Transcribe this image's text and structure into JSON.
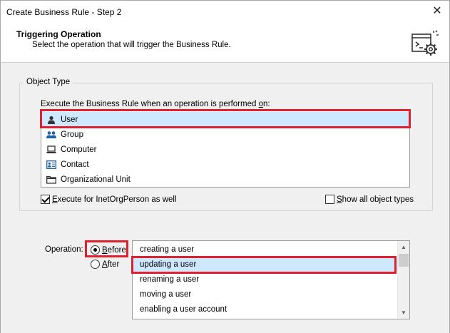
{
  "window": {
    "title": "Create Business Rule - Step 2",
    "close_glyph": "✕"
  },
  "header": {
    "title": "Triggering Operation",
    "subtitle": "Select the operation that will trigger the Business Rule.",
    "icon": "settings-gear-window-icon"
  },
  "object_type": {
    "group_label": "Object Type",
    "prompt_pre": "Execute the Business Rule when an operation is performed ",
    "prompt_accel": "o",
    "prompt_post": "n:",
    "items": [
      {
        "label": "User",
        "icon": "user-icon",
        "selected": true
      },
      {
        "label": "Group",
        "icon": "group-icon",
        "selected": false
      },
      {
        "label": "Computer",
        "icon": "computer-icon",
        "selected": false
      },
      {
        "label": "Contact",
        "icon": "contact-icon",
        "selected": false
      },
      {
        "label": "Organizational Unit",
        "icon": "folder-icon",
        "selected": false
      }
    ],
    "inetorg": {
      "accel": "E",
      "rest": "xecute for InetOrgPerson as well",
      "checked": true
    },
    "show_all": {
      "accel": "S",
      "rest": "how all object types",
      "checked": false
    }
  },
  "operation": {
    "label": "Operation:",
    "before": {
      "accel": "B",
      "rest": "efore",
      "checked": true
    },
    "after": {
      "accel": "A",
      "rest": "fter",
      "checked": false
    },
    "items": [
      {
        "label": "creating a user",
        "selected": false
      },
      {
        "label": "updating a user",
        "selected": true
      },
      {
        "label": "renaming a user",
        "selected": false
      },
      {
        "label": "moving a user",
        "selected": false
      },
      {
        "label": "enabling a user account",
        "selected": false
      }
    ]
  },
  "colors": {
    "highlight": "#e0202e",
    "selection": "#cde8ff",
    "icon_blue": "#1e5fa8"
  }
}
